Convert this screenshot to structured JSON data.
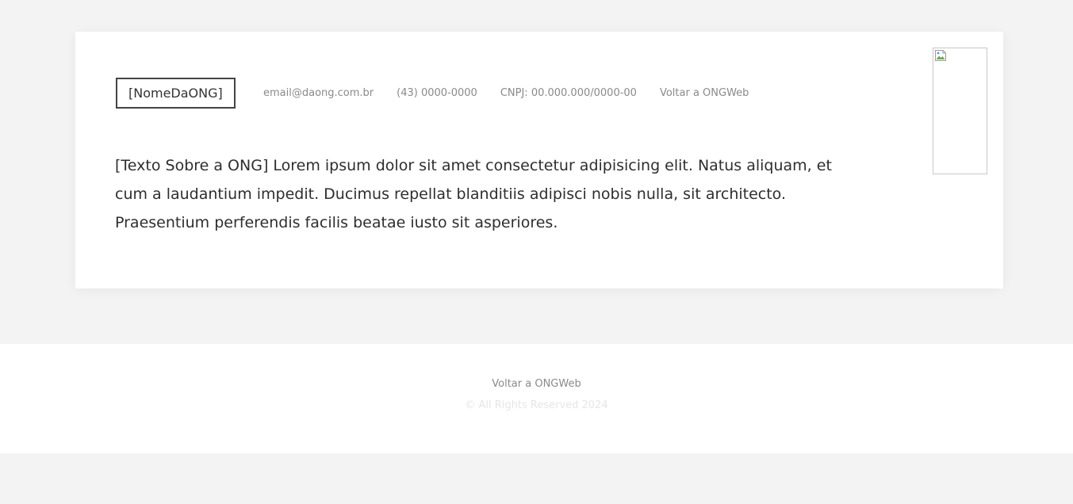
{
  "header": {
    "brand_name": "[NomeDaONG]",
    "email": "email@daong.com.br",
    "phone": "(43) 0000-0000",
    "cnpj": "CNPJ: 00.000.000/0000-00",
    "back_link": "Voltar a ONGWeb"
  },
  "about": {
    "text": "[Texto Sobre a ONG] Lorem ipsum dolor sit amet consectetur adipisicing elit. Natus aliquam, et cum a laudantium impedit. Ducimus repellat blanditiis adipisci nobis nulla, sit architecto. Praesentium perferendis facilis beatae iusto sit asperiores."
  },
  "logo": {
    "icon": "broken-image-icon"
  },
  "footer": {
    "back_link": "Voltar a ONGWeb",
    "copyright": "© All Rights Reserved 2024"
  },
  "colors": {
    "page_background": "#f3f3f3",
    "card_background": "#ffffff",
    "text_primary": "#2e2e2e",
    "text_muted": "#8a8a8a",
    "copyright_text": "#e6e6e6"
  }
}
